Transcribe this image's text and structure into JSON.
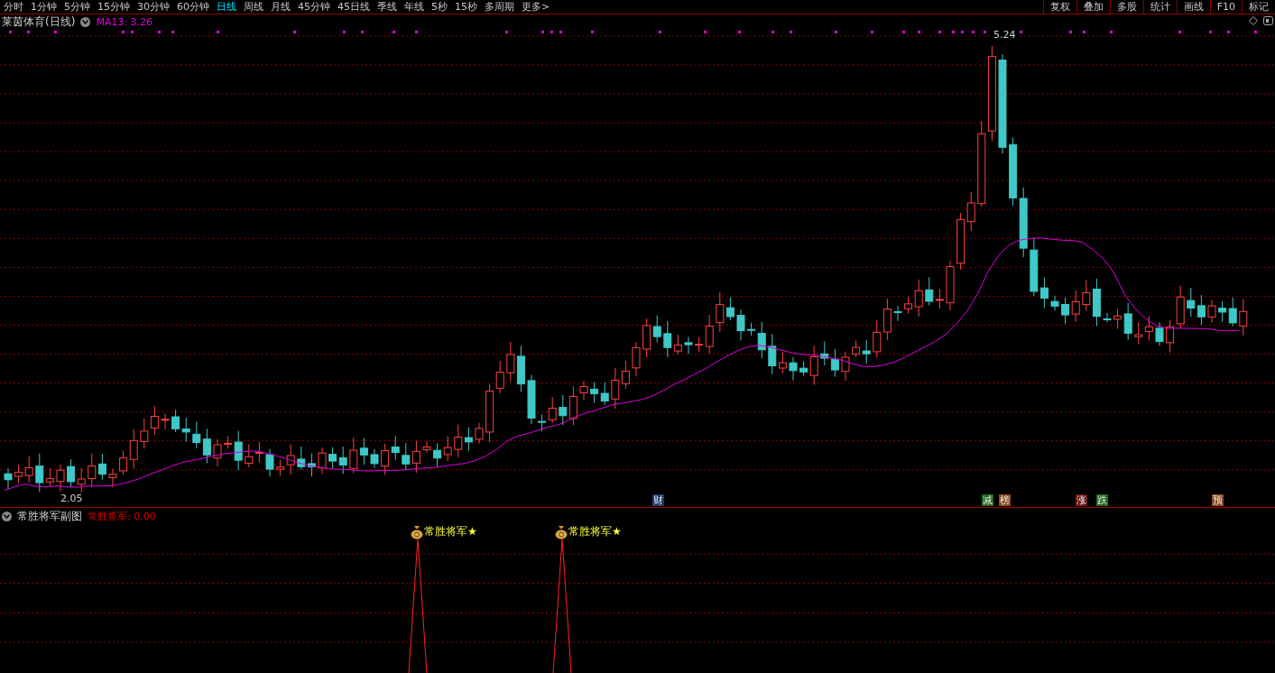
{
  "toolbar": {
    "periods": [
      {
        "label": "分时",
        "selected": false
      },
      {
        "label": "1分钟",
        "selected": false
      },
      {
        "label": "5分钟",
        "selected": false
      },
      {
        "label": "15分钟",
        "selected": false
      },
      {
        "label": "30分钟",
        "selected": false
      },
      {
        "label": "60分钟",
        "selected": false
      },
      {
        "label": "日线",
        "selected": true
      },
      {
        "label": "周线",
        "selected": false
      },
      {
        "label": "月线",
        "selected": false
      },
      {
        "label": "45分钟",
        "selected": false
      },
      {
        "label": "45日线",
        "selected": false
      },
      {
        "label": "季线",
        "selected": false
      },
      {
        "label": "年线",
        "selected": false
      },
      {
        "label": "5秒",
        "selected": false
      },
      {
        "label": "15秒",
        "selected": false
      },
      {
        "label": "多周期",
        "selected": false
      },
      {
        "label": "更多>",
        "selected": false
      }
    ],
    "tools": [
      "复权",
      "叠加",
      "多股",
      "统计",
      "画线",
      "F10",
      "标记"
    ]
  },
  "main_chart": {
    "title": "莱茵体育(日线)",
    "indicator": "MA13: 3.26",
    "high_label": "5.24",
    "low_label": "2.05",
    "event_tags": [
      {
        "text": "财",
        "color": "#1c3a6a"
      },
      {
        "text": "减",
        "color": "#1d6a1d"
      },
      {
        "text": "榜",
        "color": "#8a4a1c"
      },
      {
        "text": "涨",
        "color": "#6a1414"
      },
      {
        "text": "跌",
        "color": "#1d6a1d"
      },
      {
        "text": "预",
        "color": "#8a4a1c"
      }
    ]
  },
  "sub_chart": {
    "title": "常胜将军副图",
    "indicator": "常胜将军: 0.00",
    "signals": [
      {
        "label": "常胜将军★"
      },
      {
        "label": "常胜将军★"
      }
    ]
  }
}
